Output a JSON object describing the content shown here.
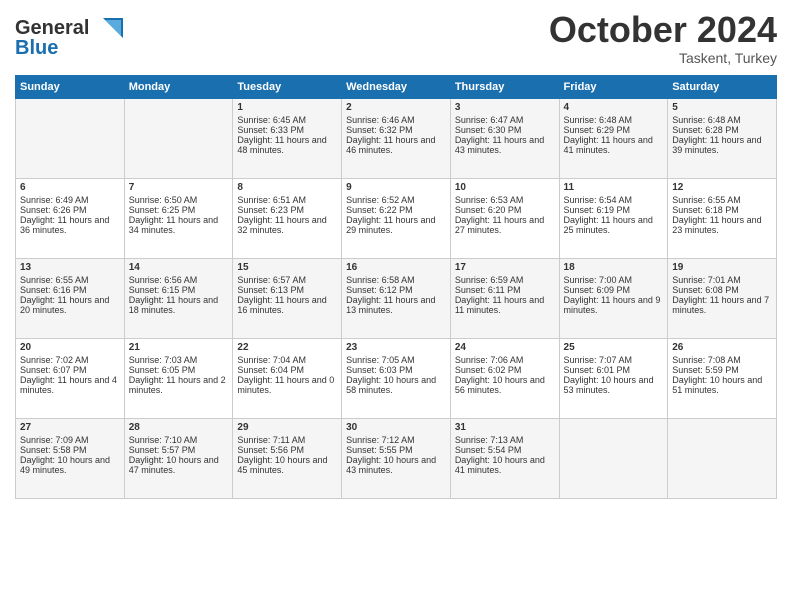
{
  "header": {
    "logo_line1": "General",
    "logo_line2": "Blue",
    "month": "October 2024",
    "location": "Taskent, Turkey"
  },
  "days_of_week": [
    "Sunday",
    "Monday",
    "Tuesday",
    "Wednesday",
    "Thursday",
    "Friday",
    "Saturday"
  ],
  "weeks": [
    [
      {
        "day": "",
        "content": ""
      },
      {
        "day": "",
        "content": ""
      },
      {
        "day": "1",
        "content": "Sunrise: 6:45 AM\nSunset: 6:33 PM\nDaylight: 11 hours and 48 minutes."
      },
      {
        "day": "2",
        "content": "Sunrise: 6:46 AM\nSunset: 6:32 PM\nDaylight: 11 hours and 46 minutes."
      },
      {
        "day": "3",
        "content": "Sunrise: 6:47 AM\nSunset: 6:30 PM\nDaylight: 11 hours and 43 minutes."
      },
      {
        "day": "4",
        "content": "Sunrise: 6:48 AM\nSunset: 6:29 PM\nDaylight: 11 hours and 41 minutes."
      },
      {
        "day": "5",
        "content": "Sunrise: 6:48 AM\nSunset: 6:28 PM\nDaylight: 11 hours and 39 minutes."
      }
    ],
    [
      {
        "day": "6",
        "content": "Sunrise: 6:49 AM\nSunset: 6:26 PM\nDaylight: 11 hours and 36 minutes."
      },
      {
        "day": "7",
        "content": "Sunrise: 6:50 AM\nSunset: 6:25 PM\nDaylight: 11 hours and 34 minutes."
      },
      {
        "day": "8",
        "content": "Sunrise: 6:51 AM\nSunset: 6:23 PM\nDaylight: 11 hours and 32 minutes."
      },
      {
        "day": "9",
        "content": "Sunrise: 6:52 AM\nSunset: 6:22 PM\nDaylight: 11 hours and 29 minutes."
      },
      {
        "day": "10",
        "content": "Sunrise: 6:53 AM\nSunset: 6:20 PM\nDaylight: 11 hours and 27 minutes."
      },
      {
        "day": "11",
        "content": "Sunrise: 6:54 AM\nSunset: 6:19 PM\nDaylight: 11 hours and 25 minutes."
      },
      {
        "day": "12",
        "content": "Sunrise: 6:55 AM\nSunset: 6:18 PM\nDaylight: 11 hours and 23 minutes."
      }
    ],
    [
      {
        "day": "13",
        "content": "Sunrise: 6:55 AM\nSunset: 6:16 PM\nDaylight: 11 hours and 20 minutes."
      },
      {
        "day": "14",
        "content": "Sunrise: 6:56 AM\nSunset: 6:15 PM\nDaylight: 11 hours and 18 minutes."
      },
      {
        "day": "15",
        "content": "Sunrise: 6:57 AM\nSunset: 6:13 PM\nDaylight: 11 hours and 16 minutes."
      },
      {
        "day": "16",
        "content": "Sunrise: 6:58 AM\nSunset: 6:12 PM\nDaylight: 11 hours and 13 minutes."
      },
      {
        "day": "17",
        "content": "Sunrise: 6:59 AM\nSunset: 6:11 PM\nDaylight: 11 hours and 11 minutes."
      },
      {
        "day": "18",
        "content": "Sunrise: 7:00 AM\nSunset: 6:09 PM\nDaylight: 11 hours and 9 minutes."
      },
      {
        "day": "19",
        "content": "Sunrise: 7:01 AM\nSunset: 6:08 PM\nDaylight: 11 hours and 7 minutes."
      }
    ],
    [
      {
        "day": "20",
        "content": "Sunrise: 7:02 AM\nSunset: 6:07 PM\nDaylight: 11 hours and 4 minutes."
      },
      {
        "day": "21",
        "content": "Sunrise: 7:03 AM\nSunset: 6:05 PM\nDaylight: 11 hours and 2 minutes."
      },
      {
        "day": "22",
        "content": "Sunrise: 7:04 AM\nSunset: 6:04 PM\nDaylight: 11 hours and 0 minutes."
      },
      {
        "day": "23",
        "content": "Sunrise: 7:05 AM\nSunset: 6:03 PM\nDaylight: 10 hours and 58 minutes."
      },
      {
        "day": "24",
        "content": "Sunrise: 7:06 AM\nSunset: 6:02 PM\nDaylight: 10 hours and 56 minutes."
      },
      {
        "day": "25",
        "content": "Sunrise: 7:07 AM\nSunset: 6:01 PM\nDaylight: 10 hours and 53 minutes."
      },
      {
        "day": "26",
        "content": "Sunrise: 7:08 AM\nSunset: 5:59 PM\nDaylight: 10 hours and 51 minutes."
      }
    ],
    [
      {
        "day": "27",
        "content": "Sunrise: 7:09 AM\nSunset: 5:58 PM\nDaylight: 10 hours and 49 minutes."
      },
      {
        "day": "28",
        "content": "Sunrise: 7:10 AM\nSunset: 5:57 PM\nDaylight: 10 hours and 47 minutes."
      },
      {
        "day": "29",
        "content": "Sunrise: 7:11 AM\nSunset: 5:56 PM\nDaylight: 10 hours and 45 minutes."
      },
      {
        "day": "30",
        "content": "Sunrise: 7:12 AM\nSunset: 5:55 PM\nDaylight: 10 hours and 43 minutes."
      },
      {
        "day": "31",
        "content": "Sunrise: 7:13 AM\nSunset: 5:54 PM\nDaylight: 10 hours and 41 minutes."
      },
      {
        "day": "",
        "content": ""
      },
      {
        "day": "",
        "content": ""
      }
    ]
  ]
}
